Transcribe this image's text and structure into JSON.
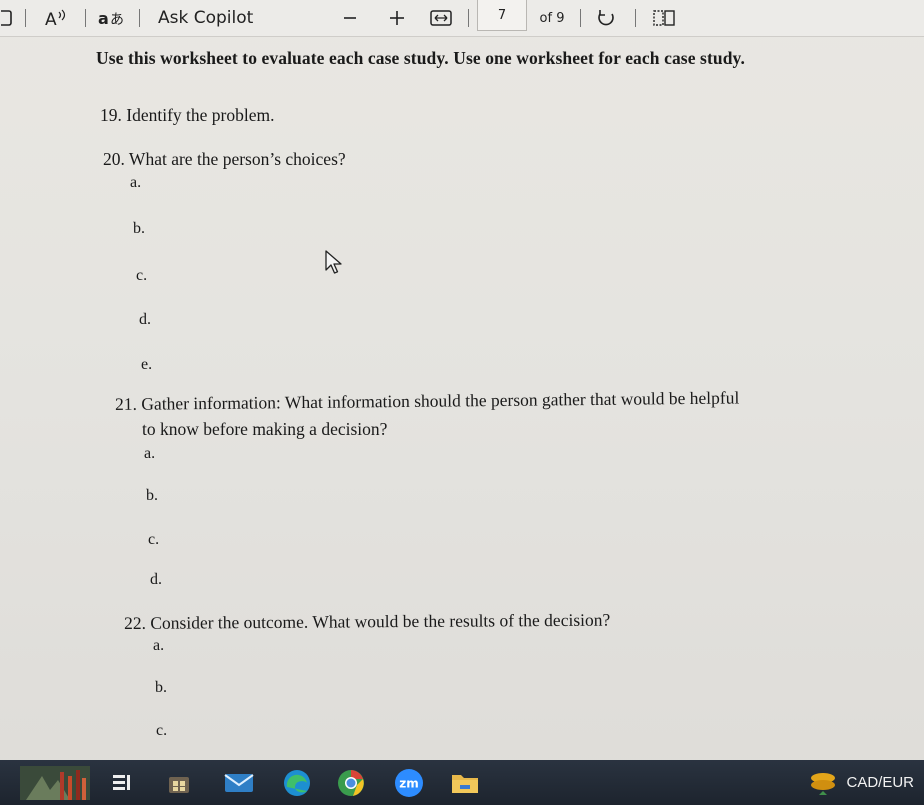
{
  "toolbar": {
    "copilot_label": "Ask Copilot",
    "zoom_out_icon": "minus-icon",
    "zoom_in_icon": "plus-icon",
    "page_number": "7",
    "page_count": "of 9",
    "icons": [
      "sidebar-icon",
      "read-aloud-icon",
      "translate-icon",
      "minus-icon",
      "plus-icon",
      "fit-width-icon",
      "rotate-icon",
      "page-view-icon"
    ]
  },
  "document": {
    "instruction": "Use this worksheet to evaluate each case study.  Use one worksheet for each case study.",
    "q19": "19. Identify the problem.",
    "q20": "20. What are the person’s choices?",
    "q20_options": [
      "a.",
      "b.",
      "c.",
      "d.",
      "e."
    ],
    "q21_line1": "21. Gather information: What information should the person gather that would be helpful",
    "q21_line2": "to know before making a decision?",
    "q21_options": [
      "a.",
      "b.",
      "c.",
      "d."
    ],
    "q22": "22. Consider the outcome.  What would be the results of the decision?",
    "q22_options": [
      "a.",
      "b.",
      "c."
    ]
  },
  "taskbar": {
    "apps": [
      "weather-widget-icon",
      "task-view-icon",
      "store-icon",
      "mail-icon",
      "edge-icon",
      "chrome-icon",
      "zoom-icon",
      "file-explorer-icon"
    ],
    "zoom_label": "zm",
    "tray_label": "CAD/EUR",
    "colors": {
      "accent_green": "#3f8f4a",
      "edge_blue": "#1d8fd1",
      "tray_gold": "#e3a51a"
    }
  }
}
